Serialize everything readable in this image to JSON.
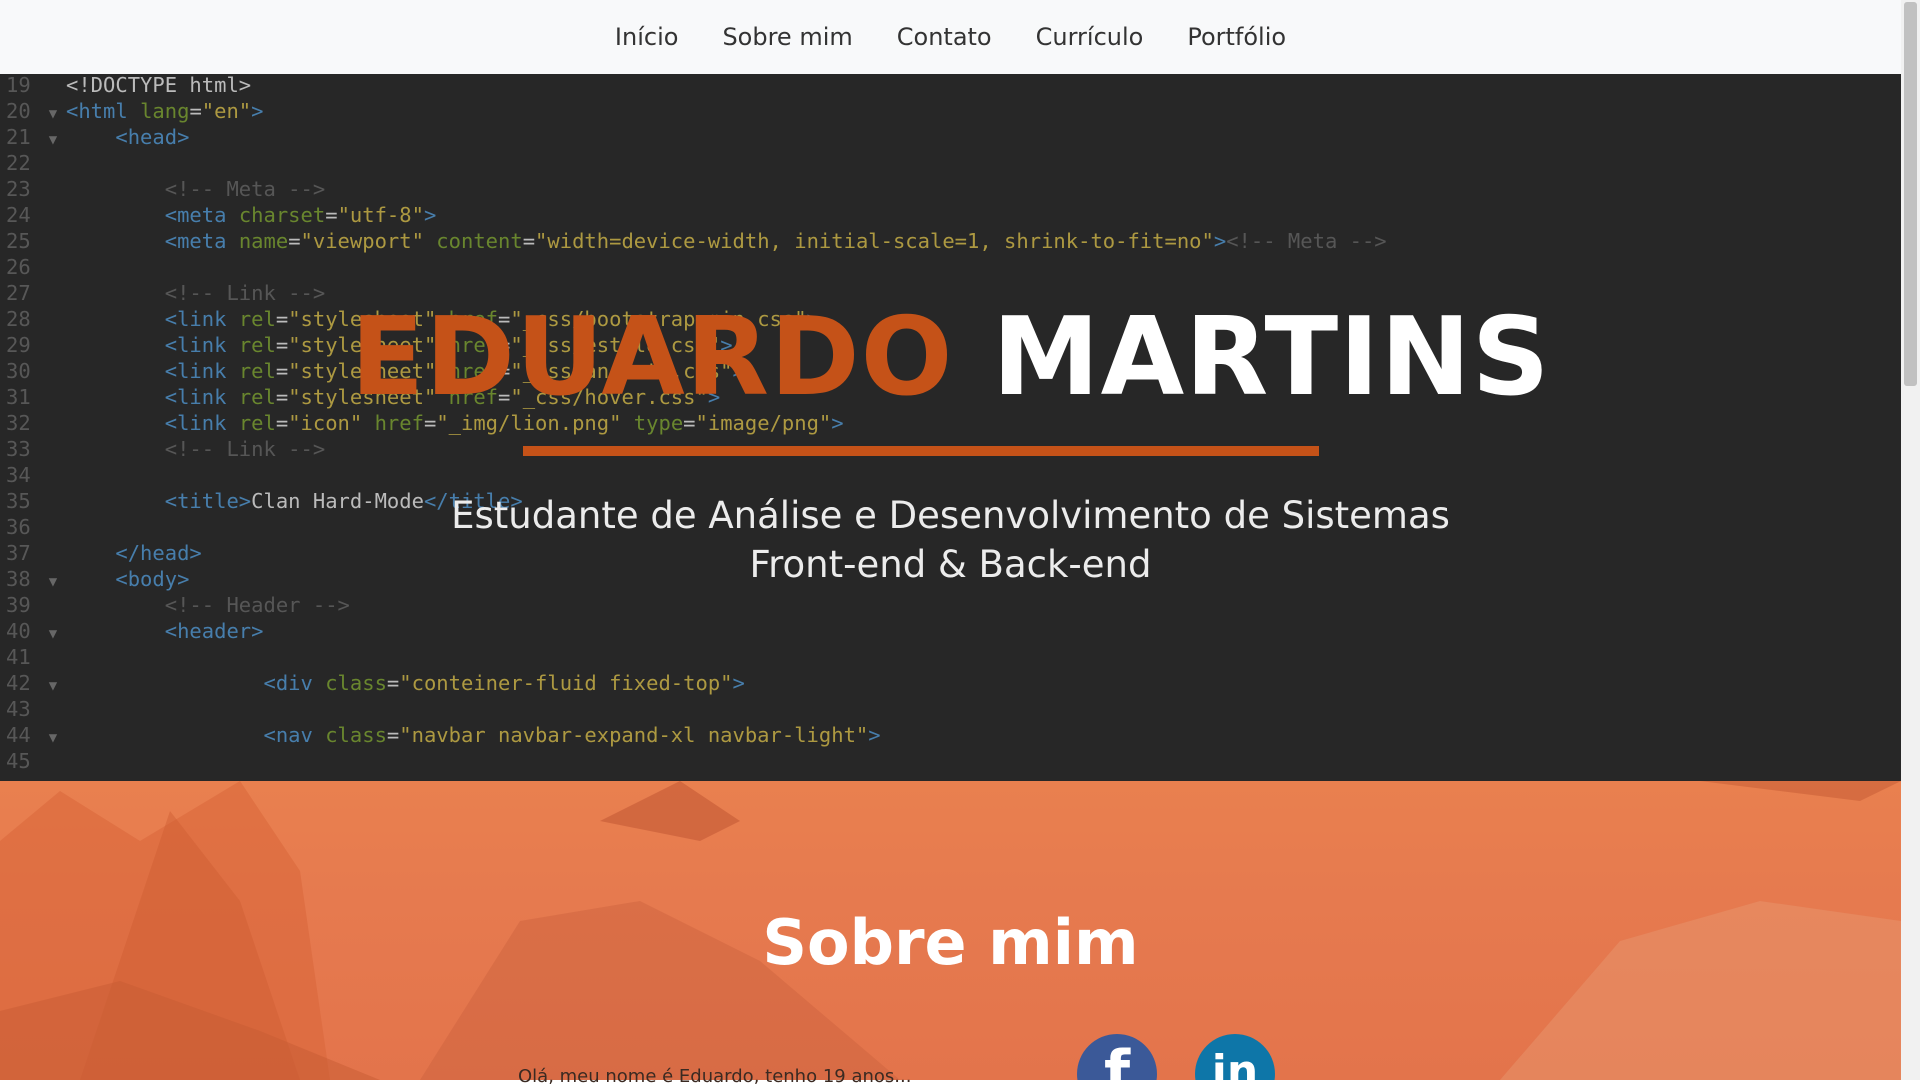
{
  "nav": {
    "items": [
      {
        "label": "Início"
      },
      {
        "label": "Sobre mim"
      },
      {
        "label": "Contato"
      },
      {
        "label": "Currículo"
      },
      {
        "label": "Portfólio"
      }
    ]
  },
  "hero": {
    "first_name": "EDUARDO",
    "last_name": "MARTINS",
    "subtitle_line1": "Estudante de Análise e Desenvolvimento de Sistemas",
    "subtitle_line2": "Front-end & Back-end",
    "code_lines": [
      {
        "n": "19",
        "fold": false,
        "indent": 0,
        "parts": [
          [
            "t",
            "<!DOCTYPE html>"
          ]
        ]
      },
      {
        "n": "20",
        "fold": true,
        "indent": 0,
        "parts": [
          [
            "g",
            "<html "
          ],
          [
            "a",
            "lang"
          ],
          [
            "e",
            "="
          ],
          [
            "s",
            "\"en\""
          ],
          [
            "g",
            ">"
          ]
        ]
      },
      {
        "n": "21",
        "fold": true,
        "indent": 1,
        "parts": [
          [
            "g",
            "<head>"
          ]
        ]
      },
      {
        "n": "22",
        "fold": false,
        "indent": 0,
        "parts": []
      },
      {
        "n": "23",
        "fold": false,
        "indent": 2,
        "parts": [
          [
            "c",
            "<!-- Meta -->"
          ]
        ]
      },
      {
        "n": "24",
        "fold": false,
        "indent": 2,
        "parts": [
          [
            "g",
            "<meta "
          ],
          [
            "a",
            "charset"
          ],
          [
            "e",
            "="
          ],
          [
            "s",
            "\"utf-8\""
          ],
          [
            "g",
            ">"
          ]
        ]
      },
      {
        "n": "25",
        "fold": false,
        "indent": 2,
        "parts": [
          [
            "g",
            "<meta "
          ],
          [
            "a",
            "name"
          ],
          [
            "e",
            "="
          ],
          [
            "s",
            "\"viewport\" "
          ],
          [
            "a",
            "content"
          ],
          [
            "e",
            "="
          ],
          [
            "s",
            "\"width=device-width, initial-scale=1, shrink-to-fit=no\""
          ],
          [
            "g",
            ">"
          ],
          [
            "c",
            "<!-- Meta -->"
          ]
        ]
      },
      {
        "n": "26",
        "fold": false,
        "indent": 0,
        "parts": []
      },
      {
        "n": "27",
        "fold": false,
        "indent": 2,
        "parts": [
          [
            "c",
            "<!-- Link -->"
          ]
        ]
      },
      {
        "n": "28",
        "fold": false,
        "indent": 2,
        "parts": [
          [
            "g",
            "<link "
          ],
          [
            "a",
            "rel"
          ],
          [
            "e",
            "="
          ],
          [
            "s",
            "\"stylesheet\" "
          ],
          [
            "a",
            "href"
          ],
          [
            "e",
            "="
          ],
          [
            "s",
            "\"_css/bootstrap.min.css\""
          ],
          [
            "g",
            ">"
          ]
        ]
      },
      {
        "n": "29",
        "fold": false,
        "indent": 2,
        "parts": [
          [
            "g",
            "<link "
          ],
          [
            "a",
            "rel"
          ],
          [
            "e",
            "="
          ],
          [
            "s",
            "\"stylesheet\" "
          ],
          [
            "a",
            "href"
          ],
          [
            "e",
            "="
          ],
          [
            "s",
            "\"_css/estilo.css\""
          ],
          [
            "g",
            ">"
          ]
        ]
      },
      {
        "n": "30",
        "fold": false,
        "indent": 2,
        "parts": [
          [
            "g",
            "<link "
          ],
          [
            "a",
            "rel"
          ],
          [
            "e",
            "="
          ],
          [
            "s",
            "\"stylesheet\" "
          ],
          [
            "a",
            "href"
          ],
          [
            "e",
            "="
          ],
          [
            "s",
            "\"_css/animate.css\""
          ],
          [
            "g",
            ">"
          ]
        ]
      },
      {
        "n": "31",
        "fold": false,
        "indent": 2,
        "parts": [
          [
            "g",
            "<link "
          ],
          [
            "a",
            "rel"
          ],
          [
            "e",
            "="
          ],
          [
            "s",
            "\"stylesheet\" "
          ],
          [
            "a",
            "href"
          ],
          [
            "e",
            "="
          ],
          [
            "s",
            "\"_css/hover.css\""
          ],
          [
            "g",
            ">"
          ]
        ]
      },
      {
        "n": "32",
        "fold": false,
        "indent": 2,
        "parts": [
          [
            "g",
            "<link "
          ],
          [
            "a",
            "rel"
          ],
          [
            "e",
            "="
          ],
          [
            "s",
            "\"icon\" "
          ],
          [
            "a",
            "href"
          ],
          [
            "e",
            "="
          ],
          [
            "s",
            "\"_img/lion.png\" "
          ],
          [
            "a",
            "type"
          ],
          [
            "e",
            "="
          ],
          [
            "s",
            "\"image/png\""
          ],
          [
            "g",
            ">"
          ]
        ]
      },
      {
        "n": "33",
        "fold": false,
        "indent": 2,
        "parts": [
          [
            "c",
            "<!-- Link -->"
          ]
        ]
      },
      {
        "n": "34",
        "fold": false,
        "indent": 0,
        "parts": []
      },
      {
        "n": "35",
        "fold": false,
        "indent": 2,
        "parts": [
          [
            "g",
            "<title>"
          ],
          [
            "t",
            "Clan Hard-Mode"
          ],
          [
            "g",
            "</title>"
          ]
        ]
      },
      {
        "n": "36",
        "fold": false,
        "indent": 0,
        "parts": []
      },
      {
        "n": "37",
        "fold": false,
        "indent": 1,
        "parts": [
          [
            "g",
            "</head>"
          ]
        ]
      },
      {
        "n": "38",
        "fold": true,
        "indent": 1,
        "parts": [
          [
            "g",
            "<body>"
          ]
        ]
      },
      {
        "n": "39",
        "fold": false,
        "indent": 2,
        "parts": [
          [
            "c",
            "<!-- Header -->"
          ]
        ]
      },
      {
        "n": "40",
        "fold": true,
        "indent": 2,
        "parts": [
          [
            "g",
            "<header>"
          ]
        ]
      },
      {
        "n": "41",
        "fold": false,
        "indent": 0,
        "parts": []
      },
      {
        "n": "42",
        "fold": true,
        "indent": 4,
        "parts": [
          [
            "g",
            "<div "
          ],
          [
            "a",
            "class"
          ],
          [
            "e",
            "="
          ],
          [
            "s",
            "\"conteiner-fluid fixed-top\""
          ],
          [
            "g",
            ">"
          ]
        ]
      },
      {
        "n": "43",
        "fold": false,
        "indent": 0,
        "parts": []
      },
      {
        "n": "44",
        "fold": true,
        "indent": 4,
        "parts": [
          [
            "g",
            "<nav "
          ],
          [
            "a",
            "class"
          ],
          [
            "e",
            "="
          ],
          [
            "s",
            "\"navbar navbar-expand-xl navbar-light\""
          ],
          [
            "g",
            ">"
          ]
        ]
      },
      {
        "n": "45",
        "fold": false,
        "indent": 0,
        "parts": []
      }
    ]
  },
  "about": {
    "title": "Sobre mim",
    "snippet": "Olá, meu nome é Eduardo, tenho 19 anos...",
    "social": [
      {
        "icon": "facebook-icon",
        "glyph": "f"
      },
      {
        "icon": "linkedin-icon",
        "glyph": "in"
      }
    ]
  },
  "colors": {
    "accent": "#c55218",
    "code_bg": "#272727",
    "about_bg": "#e67a4f",
    "facebook": "#3b5998",
    "linkedin": "#0e76a8"
  }
}
